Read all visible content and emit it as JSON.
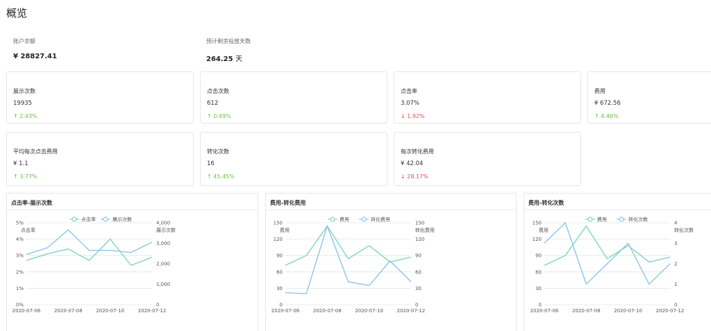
{
  "page_title": "概览",
  "summary": {
    "balance_label": "账户余额",
    "balance_value": "¥ 28827.41",
    "days_label": "预计剩余投放天数",
    "days_value": "264.25",
    "days_unit": "天"
  },
  "cards": [
    {
      "label": "展示次数",
      "value": "19935",
      "change": "↑ 2.43%",
      "direction": "up"
    },
    {
      "label": "点击次数",
      "value": "612",
      "change": "↑ 0.49%",
      "direction": "up"
    },
    {
      "label": "点击率",
      "value": "3.07%",
      "change": "↓ 1.92%",
      "direction": "down"
    },
    {
      "label": "费用",
      "value": "¥ 672.56",
      "change": "↑ 4.46%",
      "direction": "up"
    },
    {
      "label": "平均每次点击费用",
      "value": "¥ 1.1",
      "change": "↑ 3.77%",
      "direction": "up"
    },
    {
      "label": "转化次数",
      "value": "16",
      "change": "↑ 45.45%",
      "direction": "up"
    },
    {
      "label": "每次转化费用",
      "value": "¥ 42.04",
      "change": "↓ 28.17%",
      "direction": "down"
    }
  ],
  "colors": {
    "up": "#67c23a",
    "down": "#e05050",
    "series_a": "#7fd8b8",
    "series_b": "#8cc4ec",
    "grid": "#e4e4e4"
  },
  "chart_data": [
    {
      "type": "line",
      "title": "点击率-展示次数",
      "x": [
        "2020-07-06",
        "2020-07-07",
        "2020-07-08",
        "2020-07-09",
        "2020-07-10",
        "2020-07-11",
        "2020-07-12"
      ],
      "x_ticks": [
        "2020-07-06",
        "2020-07-08",
        "2020-07-10",
        "2020-07-12"
      ],
      "ylabel_left": "点击率",
      "ylabel_right": "展示次数",
      "left_ticks": [
        "0%",
        "1%",
        "2%",
        "3%",
        "4%",
        "5%"
      ],
      "right_ticks": [
        "0",
        "1,000",
        "2,000",
        "3,000",
        "4,000"
      ],
      "ylim_left": [
        0,
        5
      ],
      "ylim_right": [
        0,
        4000
      ],
      "series": [
        {
          "name": "点击率",
          "axis": "left",
          "values": [
            2.7,
            3.1,
            3.4,
            2.7,
            4.0,
            2.4,
            2.9
          ]
        },
        {
          "name": "展示次数",
          "axis": "right",
          "values": [
            2450,
            2780,
            3650,
            2650,
            2650,
            2550,
            3050
          ]
        }
      ]
    },
    {
      "type": "line",
      "title": "费用-转化费用",
      "x": [
        "2020-07-06",
        "2020-07-07",
        "2020-07-08",
        "2020-07-09",
        "2020-07-10",
        "2020-07-11",
        "2020-07-12"
      ],
      "x_ticks": [
        "2020-07-06",
        "2020-07-08",
        "2020-07-10",
        "2020-07-12"
      ],
      "ylabel_left": "费用",
      "ylabel_right": "转化费用",
      "left_ticks": [
        "0",
        "30",
        "60",
        "90",
        "120",
        "150"
      ],
      "right_ticks": [
        "0",
        "30",
        "60",
        "90",
        "120",
        "150"
      ],
      "ylim_left": [
        0,
        150
      ],
      "ylim_right": [
        0,
        150
      ],
      "series": [
        {
          "name": "费用",
          "axis": "left",
          "values": [
            72,
            90,
            144,
            84,
            108,
            78,
            87
          ]
        },
        {
          "name": "转化费用",
          "axis": "right",
          "values": [
            22,
            20,
            144,
            42,
            35,
            80,
            42
          ]
        }
      ]
    },
    {
      "type": "line",
      "title": "费用-转化次数",
      "x": [
        "2020-07-06",
        "2020-07-07",
        "2020-07-08",
        "2020-07-09",
        "2020-07-10",
        "2020-07-11",
        "2020-07-12"
      ],
      "x_ticks": [
        "2020-07-06",
        "2020-07-08",
        "2020-07-10",
        "2020-07-12"
      ],
      "ylabel_left": "费用",
      "ylabel_right": "转化次数",
      "left_ticks": [
        "0",
        "30",
        "60",
        "90",
        "120",
        "150"
      ],
      "right_ticks": [
        "0",
        "1",
        "2",
        "3",
        "4"
      ],
      "ylim_left": [
        0,
        150
      ],
      "ylim_right": [
        0,
        4
      ],
      "series": [
        {
          "name": "费用",
          "axis": "left",
          "values": [
            72,
            90,
            144,
            84,
            108,
            78,
            87
          ]
        },
        {
          "name": "转化次数",
          "axis": "right",
          "values": [
            3,
            4,
            1,
            2,
            3,
            1,
            2
          ]
        }
      ]
    }
  ]
}
